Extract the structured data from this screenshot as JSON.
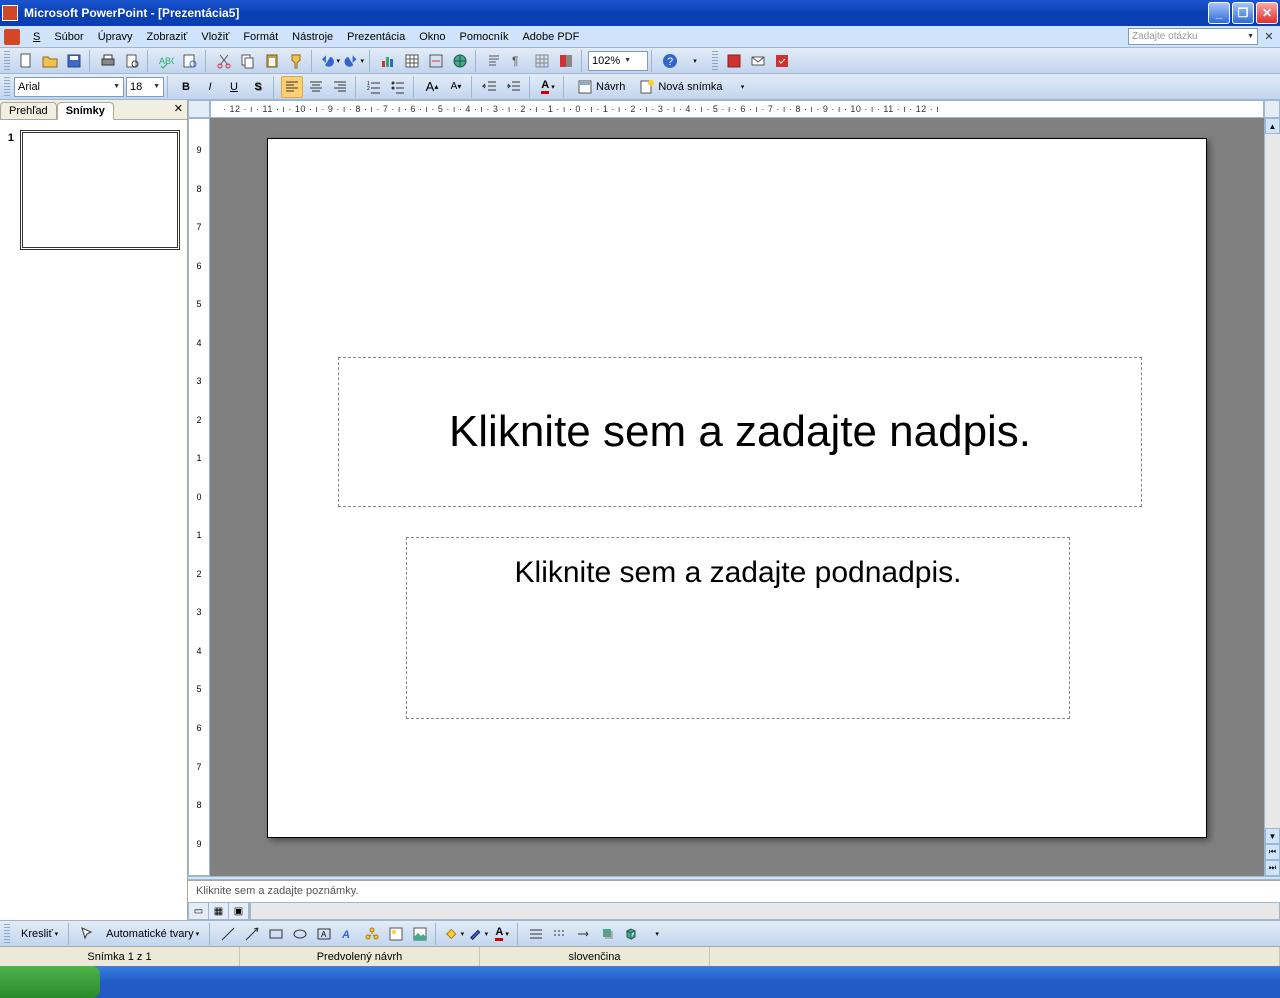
{
  "titlebar": {
    "title": "Microsoft PowerPoint - [Prezentácia5]"
  },
  "menus": {
    "file": "Súbor",
    "edit": "Úpravy",
    "view": "Zobraziť",
    "insert": "Vložiť",
    "format": "Formát",
    "tools": "Nástroje",
    "slideshow": "Prezentácia",
    "window": "Okno",
    "help": "Pomocník",
    "adobe": "Adobe PDF"
  },
  "ask_box": {
    "placeholder": "Zadajte otázku"
  },
  "format_toolbar": {
    "font": "Arial",
    "size": "18",
    "design_label": "Návrh",
    "newslide_label": "Nová snímka"
  },
  "standard_toolbar": {
    "zoom": "102%"
  },
  "left_panel": {
    "tab_outline": "Prehľad",
    "tab_slides": "Snímky",
    "slide_num": "1"
  },
  "ruler_h": "· 12 · ı · 11 · ı · 10 · ı · 9 · ı · 8 · ı · 7 · ı · 6 · ı · 5 · ı · 4 · ı · 3 · ı · 2 · ı · 1 · ı · 0 · ı · 1 · ı · 2 · ı · 3 · ı · 4 · ı · 5 · ı · 6 · ı · 7 · ı · 8 · ı · 9 · ı · 10 · ı · 11 · ı · 12 · ı",
  "ruler_v": [
    "9",
    "8",
    "7",
    "6",
    "5",
    "4",
    "3",
    "2",
    "1",
    "0",
    "1",
    "2",
    "3",
    "4",
    "5",
    "6",
    "7",
    "8",
    "9"
  ],
  "slide": {
    "title_placeholder": "Kliknite sem a zadajte nadpis.",
    "subtitle_placeholder": "Kliknite sem a zadajte podnadpis."
  },
  "notes_placeholder": "Kliknite sem a zadajte poznámky.",
  "drawbar": {
    "draw_label": "Kresliť",
    "autoshapes_label": "Automatické tvary"
  },
  "status": {
    "slide": "Snímka 1 z 1",
    "design": "Predvolený návrh",
    "lang": "slovenčina"
  }
}
